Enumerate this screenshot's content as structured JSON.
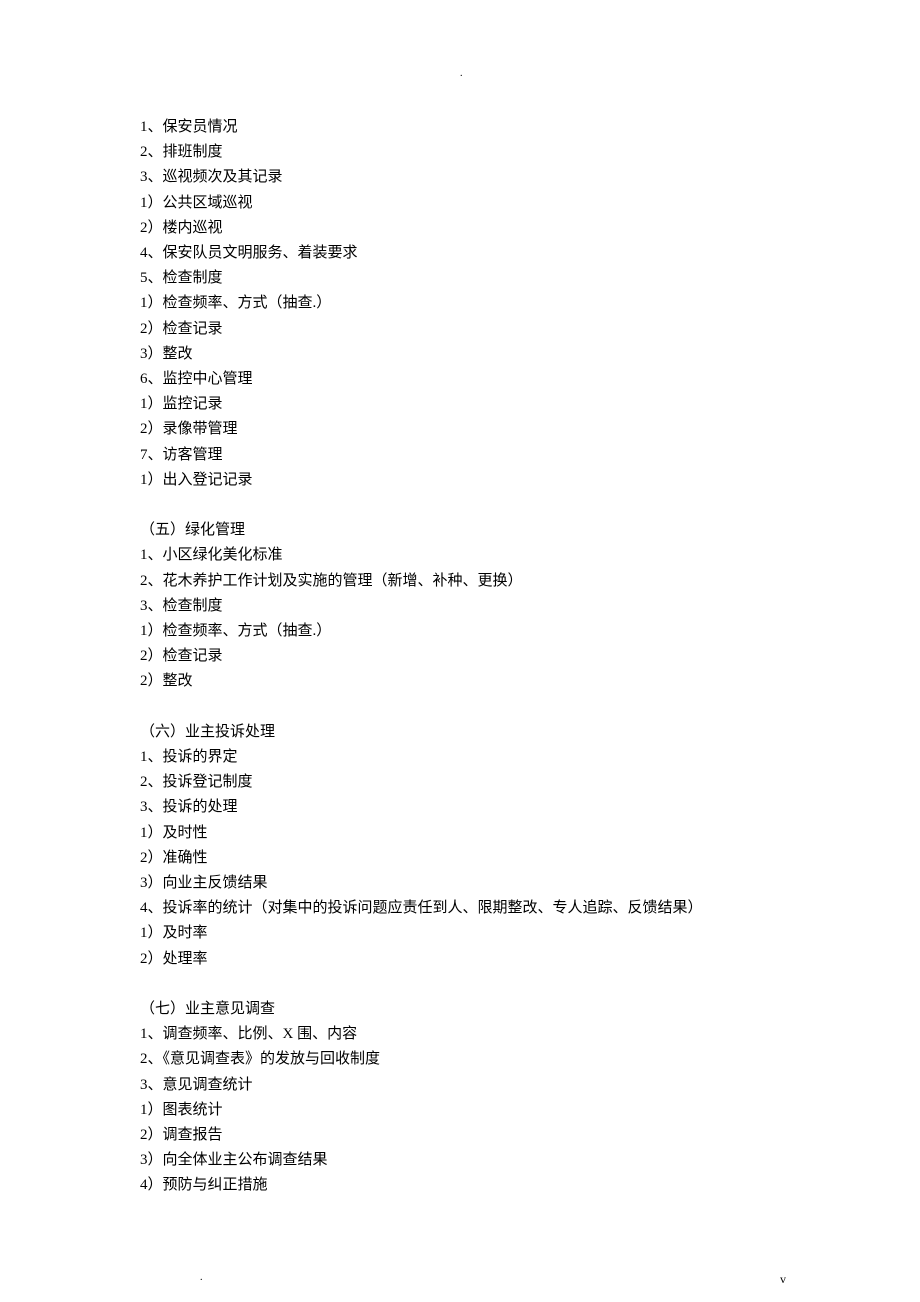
{
  "top_marker": ".",
  "bottom_marker": ".",
  "footer": "v",
  "lines": [
    "1、保安员情况",
    "2、排班制度",
    "3、巡视频次及其记录",
    "1）公共区域巡视",
    "2）楼内巡视",
    "4、保安队员文明服务、着装要求",
    "5、检查制度",
    "1）检查频率、方式（抽查.）",
    "2）检查记录",
    "3）整改",
    "6、监控中心管理",
    "1）监控记录",
    "2）录像带管理",
    "7、访客管理",
    "1）出入登记记录",
    "",
    "（五）绿化管理",
    "1、小区绿化美化标准",
    "2、花木养护工作计划及实施的管理（新增、补种、更换）",
    "3、检查制度",
    "1）检查频率、方式（抽查.）",
    "2）检查记录",
    "2）整改",
    "",
    "（六）业主投诉处理",
    "1、投诉的界定",
    "2、投诉登记制度",
    "3、投诉的处理",
    "1）及时性",
    "2）准确性",
    "3）向业主反馈结果",
    "4、投诉率的统计（对集中的投诉问题应责任到人、限期整改、专人追踪、反馈结果）",
    "1）及时率",
    "2）处理率",
    "",
    "（七）业主意见调查",
    "1、调查频率、比例、X 围、内容",
    "2、《意见调查表》的发放与回收制度",
    "3、意见调查统计",
    "1）图表统计",
    "2）调查报告",
    "3）向全体业主公布调查结果",
    "4）预防与纠正措施"
  ]
}
